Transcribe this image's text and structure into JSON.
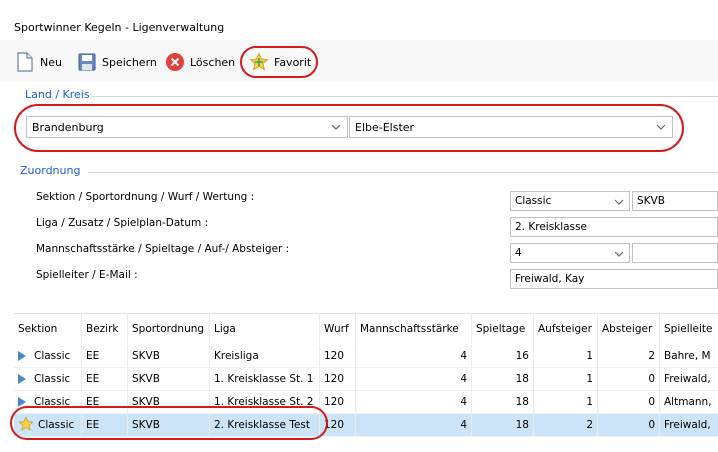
{
  "window": {
    "title": "Sportwinner Kegeln - Ligenverwaltung"
  },
  "toolbar": {
    "new_label": "Neu",
    "save_label": "Speichern",
    "delete_label": "Löschen",
    "favorite_label": "Favorit"
  },
  "land_kreis": {
    "group_title": "Land / Kreis",
    "land": "Brandenburg",
    "kreis": "Elbe-Elster"
  },
  "zuordnung": {
    "group_title": "Zuordnung",
    "labels": [
      "Sektion / Sportordnung / Wurf / Wertung :",
      "Liga / Zusatz / Spielplan-Datum :",
      "Mannschaftsstärke / Spieltage / Auf-/ Absteiger :",
      "Spielleiter / E-Mail :"
    ],
    "sektion": "Classic",
    "sportordnung": "SKVB",
    "liga": "2. Kreisklasse",
    "mannschaftsstaerke": "4",
    "spieltage": "",
    "spielleiter": "Freiwald, Kay"
  },
  "table": {
    "headers": [
      "Sektion",
      "Bezirk",
      "Sportordnung",
      "Liga",
      "Wurf",
      "Mannschaftsstärke",
      "Spieltage",
      "Aufsteiger",
      "Absteiger",
      "Spielleite"
    ],
    "rows": [
      [
        "Classic",
        "EE",
        "SKVB",
        "Kreisliga",
        "120",
        "4",
        "16",
        "1",
        "2",
        "Bahre, M"
      ],
      [
        "Classic",
        "EE",
        "SKVB",
        "1. Kreisklasse St. 1",
        "120",
        "4",
        "18",
        "1",
        "0",
        "Freiwald,"
      ],
      [
        "Classic",
        "EE",
        "SKVB",
        "1. Kreisklasse St. 2",
        "120",
        "4",
        "18",
        "1",
        "0",
        "Altmann,"
      ],
      [
        "Classic",
        "EE",
        "SKVB",
        "2. Kreisklasse Test",
        "120",
        "4",
        "18",
        "2",
        "0",
        "Freiwald,"
      ]
    ]
  },
  "colors": {
    "accent": "#1a5fd8",
    "selection": "#cce4f7",
    "annotation": "#d41b1b"
  }
}
